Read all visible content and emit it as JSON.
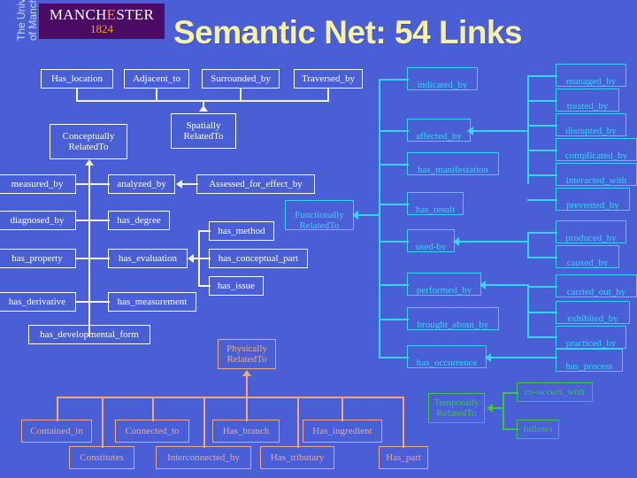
{
  "slide": {
    "title": "Semantic Net: 54 Links",
    "logo": {
      "word_before": "MANCH",
      "word_e": "E",
      "word_after": "STER",
      "year": "1824",
      "vertical": "The University\nof Manchester"
    }
  },
  "groups": {
    "spatial": {
      "hub": "Spatially\nRelatedTo",
      "hub_line1": "Spatially",
      "hub_line2": "RelatedTo",
      "children": [
        "Has_location",
        "Adjacent_to",
        "Surrounded_by",
        "Traversed_by"
      ]
    },
    "conceptual": {
      "hub_line1": "Conceptually",
      "hub_line2": "RelatedTo",
      "children_left": [
        "measured_by",
        "diagnosed_by",
        "has_property",
        "has_derivative"
      ],
      "children_right": [
        "analyzed_by",
        "has_degree",
        "has_evaluation",
        "has_measurement"
      ],
      "child_bottom": "has_developmental_form",
      "analyzed_source": "Assessed_for_effect_by",
      "evaluation_sources": [
        "has_method",
        "has_conceptual_part",
        "has_issue"
      ]
    },
    "functional": {
      "hub_line1": "Functionally",
      "hub_line2": "RelatedTo",
      "column_mid": [
        "indicated_by",
        "affected_by",
        "has_manifestation",
        "has_result",
        "used-by",
        "performed_by",
        "brought_about_by",
        "has_occurrence"
      ],
      "column_right": [
        "managed_by",
        "treated_by",
        "disrupted_by",
        "complicated_by",
        "interacted_with",
        "prevented_by",
        "produced_by",
        "caused_by",
        "carried_out_by",
        "exhibited_by",
        "practiced_by",
        "has_process"
      ]
    },
    "physical": {
      "hub_line1": "Physically",
      "hub_line2": "RelatedTo",
      "row_top": [
        "Contained_in",
        "Connected_to",
        "Has_branch",
        "Has_ingredient"
      ],
      "row_bottom": [
        "Constitutes",
        "Interconnected_by",
        "Has_tributary",
        "Has_part"
      ]
    },
    "temporal": {
      "hub_line1": "Temporally",
      "hub_line2": "RelatedTo",
      "children": [
        "co-occurs_with",
        "follows"
      ]
    }
  },
  "colors": {
    "background": "#4a5fd6",
    "title": "#f7f0a8",
    "white_group": "#ffffff",
    "white_connector": "#f4f2d8",
    "cyan_group": "#35d6f5",
    "orange_group": "#f0a882",
    "green_group": "#39c83c",
    "logo_bg": "#4b0a64",
    "logo_accent": "#f0a028"
  }
}
